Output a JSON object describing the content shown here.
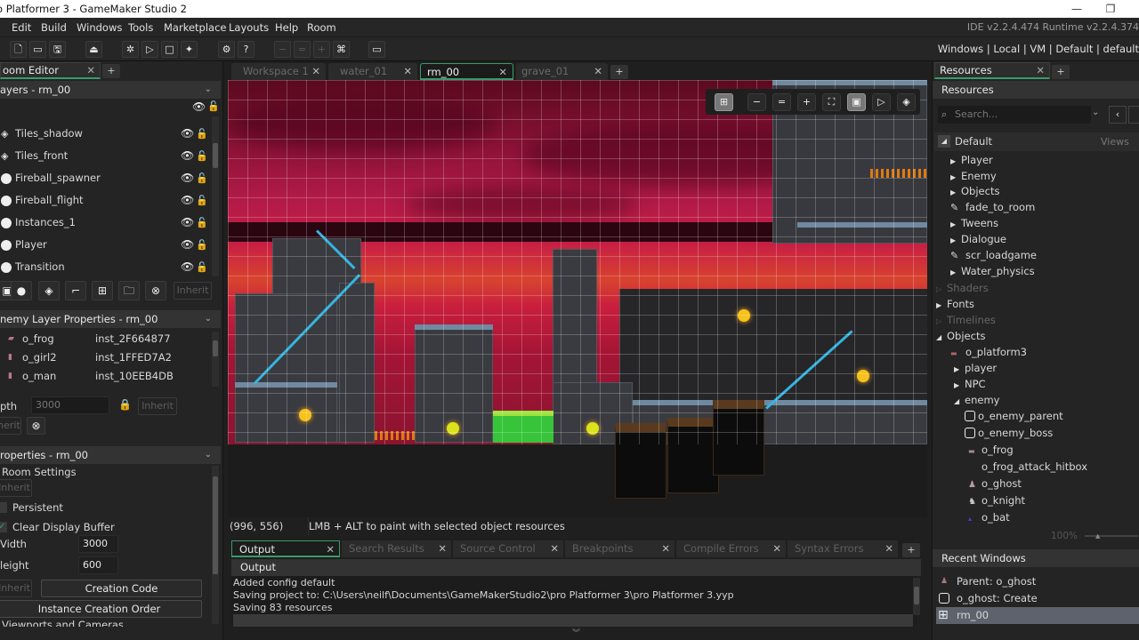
{
  "window": {
    "title": "o Platformer 3 - GameMaker Studio 2",
    "minimize": "—",
    "maximize": "❐"
  },
  "menu": {
    "items": [
      "Edit",
      "Build",
      "Windows",
      "Tools",
      "Marketplace",
      "Layouts",
      "Help",
      "Room"
    ],
    "version": "IDE v2.2.4.474  Runtime v2.2.4.374"
  },
  "toolbar": {
    "icons": [
      "new-file",
      "open-folder",
      "save",
      "package",
      "debug",
      "run",
      "stop",
      "clean",
      "settings",
      "help",
      "zoom-out",
      "zoom-reset",
      "zoom-in",
      "gamepad",
      "monitor"
    ],
    "targets": "Windows | Local | VM | Default | default"
  },
  "left_panel": {
    "tab": "oom Editor",
    "layers_header": "ayers - rm_00",
    "layers": [
      {
        "name": "Tiles_shadow",
        "type": "tile"
      },
      {
        "name": "Tiles_front",
        "type": "tile"
      },
      {
        "name": "Fireball_spawner",
        "type": "instance"
      },
      {
        "name": "Fireball_flight",
        "type": "instance"
      },
      {
        "name": "Instances_1",
        "type": "instance"
      },
      {
        "name": "Player",
        "type": "instance"
      },
      {
        "name": "Transition",
        "type": "instance"
      }
    ],
    "layer_buttons_inherit": "Inherit",
    "enemy_header": "nemy Layer Properties - rm_00",
    "instances": [
      {
        "object": "o_frog",
        "id": "inst_2F664877"
      },
      {
        "object": "o_girl2",
        "id": "inst_1FFED7A2"
      },
      {
        "object": "o_man",
        "id": "inst_10EEB4DB"
      }
    ],
    "depth_label": "pth",
    "depth_value": "3000",
    "inherit": "Inherit",
    "inherit_partial": "nerit",
    "props_header": "roperties - rm_00",
    "room_settings": "Room Settings",
    "inherit2": "Inherit",
    "persistent": "Persistent",
    "persistent_checked": false,
    "clear_display": "Clear Display Buffer",
    "clear_display_checked": true,
    "width_label": "Vidth",
    "width_value": "3000",
    "height_label": "leight",
    "height_value": "600",
    "inherit3": "Inherit",
    "creation_code": "Creation Code",
    "instance_order": "Instance Creation Order",
    "viewports": "Viewports and Cameras"
  },
  "doc_tabs": [
    {
      "label": "Workspace 1",
      "active": false
    },
    {
      "label": "water_01",
      "active": false
    },
    {
      "label": "rm_00",
      "active": true
    },
    {
      "label": "grave_01",
      "active": false
    }
  ],
  "canvas_toolbar": [
    "grid",
    "zoom-out",
    "zoom-reset",
    "zoom-in",
    "fit",
    "frame",
    "play",
    "layers"
  ],
  "status": {
    "coords": "(996, 556)",
    "hint": "LMB + ALT to paint with selected object resources"
  },
  "output": {
    "tabs": [
      "Output",
      "Search Results",
      "Source Control",
      "Breakpoints",
      "Compile Errors",
      "Syntax Errors"
    ],
    "header": "Output",
    "lines": [
      "Added config default",
      "Saving project to: C:\\Users\\neilf\\Documents\\GameMakerStudio2\\pro Platformer 3\\pro Platformer 3.yyp",
      "Saving 83 resources"
    ]
  },
  "resources": {
    "tab": "Resources",
    "header": "Resources",
    "search_placeholder": "Search...",
    "default_label": "Default",
    "views_label": "Views",
    "tree": [
      {
        "label": "Player",
        "kind": "folder"
      },
      {
        "label": "Enemy",
        "kind": "folder"
      },
      {
        "label": "Objects",
        "kind": "folder"
      },
      {
        "label": "fade_to_room",
        "kind": "script"
      },
      {
        "label": "Tweens",
        "kind": "folder"
      },
      {
        "label": "Dialogue",
        "kind": "folder"
      },
      {
        "label": "scr_loadgame",
        "kind": "script"
      },
      {
        "label": "Water_physics",
        "kind": "folder"
      }
    ],
    "groups": [
      {
        "label": "Shaders",
        "dim": true
      },
      {
        "label": "Fonts",
        "dim": false
      },
      {
        "label": "Timelines",
        "dim": true
      },
      {
        "label": "Objects",
        "dim": false,
        "expanded": true
      }
    ],
    "objects": [
      {
        "label": "o_platform3",
        "indent": 1
      },
      {
        "label": "player",
        "indent": 1,
        "folder": true
      },
      {
        "label": "NPC",
        "indent": 1,
        "folder": true
      },
      {
        "label": "enemy",
        "indent": 1,
        "folder": true,
        "expanded": true
      },
      {
        "label": "o_enemy_parent",
        "indent": 2
      },
      {
        "label": "o_enemy_boss",
        "indent": 2
      },
      {
        "label": "o_frog",
        "indent": 2
      },
      {
        "label": "o_frog_attack_hitbox",
        "indent": 2
      },
      {
        "label": "o_ghost",
        "indent": 2
      },
      {
        "label": "o_knight",
        "indent": 2
      },
      {
        "label": "o_bat",
        "indent": 2
      }
    ],
    "zoom": "100%",
    "recent_header": "Recent Windows",
    "recent": [
      {
        "label": "Parent: o_ghost",
        "selected": false
      },
      {
        "label": "o_ghost: Create",
        "selected": false
      },
      {
        "label": "rm_00",
        "selected": true
      }
    ]
  }
}
